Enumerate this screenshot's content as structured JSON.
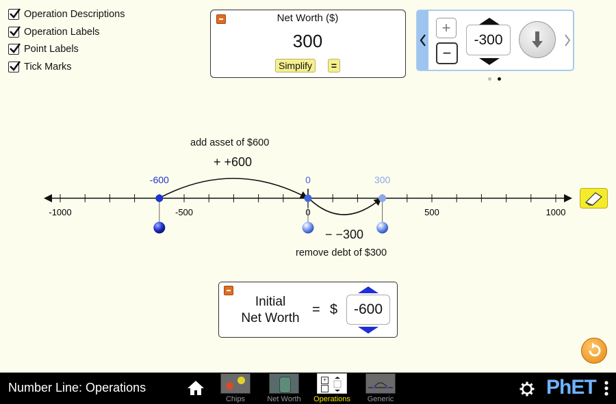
{
  "checkboxes": [
    {
      "label": "Operation Descriptions",
      "checked": true
    },
    {
      "label": "Operation Labels",
      "checked": true
    },
    {
      "label": "Point Labels",
      "checked": true
    },
    {
      "label": "Tick Marks",
      "checked": true
    }
  ],
  "net_worth_panel": {
    "title": "Net Worth ($)",
    "value": "300",
    "simplify_label": "Simplify",
    "equals_label": "="
  },
  "operation_controls": {
    "value": "-300",
    "plus_label": "+",
    "minus_label": "−",
    "page_count": 2,
    "active_page": 2
  },
  "number_line": {
    "min": -1000,
    "max": 1000,
    "tick_step": 100,
    "tick_labels": [
      "-1000",
      "-500",
      "0",
      "500",
      "1000"
    ],
    "points": [
      {
        "label": "-600",
        "value": -600,
        "color": "#2233cc"
      },
      {
        "label": "0",
        "value": 0,
        "color": "#4466dd"
      },
      {
        "label": "300",
        "value": 300,
        "color": "#8aa9e8"
      }
    ],
    "operations": [
      {
        "description": "add asset of $600",
        "label": "+ +600"
      },
      {
        "description": "remove debt of $300",
        "label": "− −300"
      }
    ]
  },
  "initial_net_worth": {
    "label_line1": "Initial",
    "label_line2": "Net Worth",
    "equals": "=",
    "currency": "$",
    "value": "-600"
  },
  "navbar": {
    "title": "Number Line: Operations",
    "tabs": [
      {
        "label": "Chips",
        "active": false
      },
      {
        "label": "Net Worth",
        "active": false
      },
      {
        "label": "Operations",
        "active": true
      },
      {
        "label": "Generic",
        "active": false
      }
    ],
    "brand": "PhET"
  },
  "colors": {
    "background": "#fdfdee",
    "accent_orange": "#e06d22",
    "active_tab": "#f2e400",
    "carousel_border": "#a9c9ee"
  }
}
